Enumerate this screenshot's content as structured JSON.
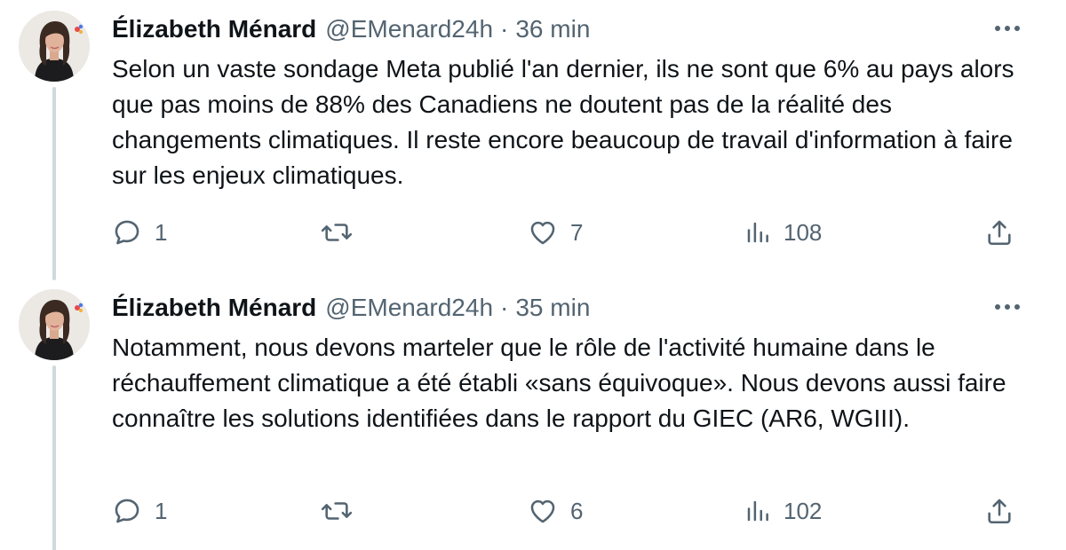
{
  "tweets": [
    {
      "author": {
        "name": "Élizabeth Ménard",
        "handle": "@EMenard24h"
      },
      "separator": "·",
      "time": "36 min",
      "text": "Selon un vaste sondage Meta publié l'an dernier, ils ne sont que 6% au pays alors que pas moins de 88% des Canadiens ne doutent pas de la réalité des changements climatiques. Il reste encore beaucoup de travail d'information à faire sur les enjeux climatiques.",
      "metrics": {
        "replies": "1",
        "likes": "7",
        "views": "108"
      }
    },
    {
      "author": {
        "name": "Élizabeth Ménard",
        "handle": "@EMenard24h"
      },
      "separator": "·",
      "time": "35 min",
      "text": "Notamment, nous devons marteler que le rôle de l'activité humaine dans le réchauffement climatique a été établi «sans équivoque». Nous devons aussi faire connaître les solutions identifiées dans le rapport du GIEC (AR6, WGIII).",
      "metrics": {
        "replies": "1",
        "likes": "6",
        "views": "102"
      }
    }
  ],
  "icons": {
    "reply": "reply-icon",
    "retweet": "retweet-icon",
    "like": "heart-icon",
    "views": "views-icon",
    "share": "share-icon",
    "more": "more-icon"
  },
  "colors": {
    "text": "#0f1419",
    "secondary": "#536471",
    "thread_line": "#cfd9de"
  }
}
